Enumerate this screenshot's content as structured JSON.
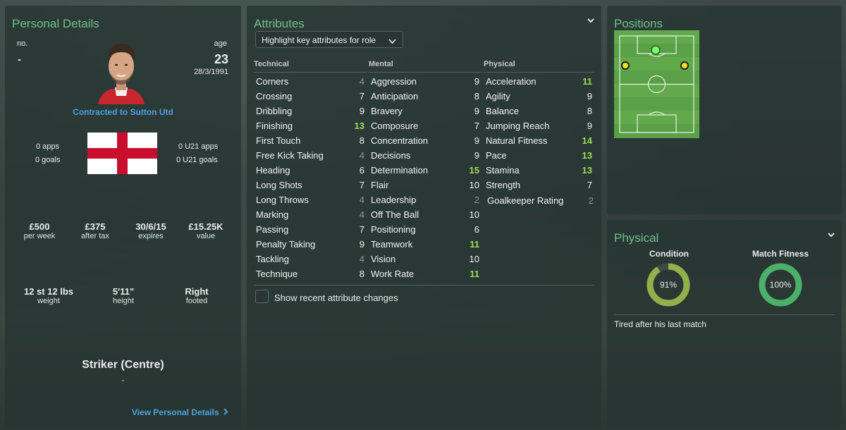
{
  "personal": {
    "title": "Personal Details",
    "no_label": "no.",
    "no_value": "-",
    "age_label": "age",
    "age_value": "23",
    "dob": "28/3/1991",
    "contract": "Contracted to Sutton Utd",
    "apps": "0 apps",
    "goals": "0 goals",
    "u21_apps": "0 U21 apps",
    "u21_goals": "0 U21 goals",
    "wage": "£500",
    "wage_label": "per week",
    "after_tax": "£375",
    "after_tax_label": "after tax",
    "expires": "30/6/15",
    "expires_label": "expires",
    "value": "£15.25K",
    "value_label": "value",
    "weight": "12 st 12 lbs",
    "weight_label": "weight",
    "height": "5'11\"",
    "height_label": "height",
    "foot": "Right",
    "foot_label": "footed",
    "position": "Striker (Centre)",
    "role": "-",
    "view_link": "View Personal Details"
  },
  "attributes": {
    "title": "Attributes",
    "dropdown": "Highlight key attributes for role",
    "col_technical": "Technical",
    "col_mental": "Mental",
    "col_physical": "Physical",
    "technical": [
      {
        "name": "Corners",
        "value": "4"
      },
      {
        "name": "Crossing",
        "value": "7"
      },
      {
        "name": "Dribbling",
        "value": "9"
      },
      {
        "name": "Finishing",
        "value": "13"
      },
      {
        "name": "First Touch",
        "value": "8"
      },
      {
        "name": "Free Kick Taking",
        "value": "4"
      },
      {
        "name": "Heading",
        "value": "6"
      },
      {
        "name": "Long Shots",
        "value": "7"
      },
      {
        "name": "Long Throws",
        "value": "4"
      },
      {
        "name": "Marking",
        "value": "4"
      },
      {
        "name": "Passing",
        "value": "7"
      },
      {
        "name": "Penalty Taking",
        "value": "9"
      },
      {
        "name": "Tackling",
        "value": "4"
      },
      {
        "name": "Technique",
        "value": "8"
      }
    ],
    "mental": [
      {
        "name": "Aggression",
        "value": "9"
      },
      {
        "name": "Anticipation",
        "value": "8"
      },
      {
        "name": "Bravery",
        "value": "9"
      },
      {
        "name": "Composure",
        "value": "7"
      },
      {
        "name": "Concentration",
        "value": "9"
      },
      {
        "name": "Decisions",
        "value": "9"
      },
      {
        "name": "Determination",
        "value": "15"
      },
      {
        "name": "Flair",
        "value": "10"
      },
      {
        "name": "Leadership",
        "value": "2"
      },
      {
        "name": "Off The Ball",
        "value": "10"
      },
      {
        "name": "Positioning",
        "value": "6"
      },
      {
        "name": "Teamwork",
        "value": "11"
      },
      {
        "name": "Vision",
        "value": "10"
      },
      {
        "name": "Work Rate",
        "value": "11"
      }
    ],
    "physical": [
      {
        "name": "Acceleration",
        "value": "11"
      },
      {
        "name": "Agility",
        "value": "9"
      },
      {
        "name": "Balance",
        "value": "8"
      },
      {
        "name": "Jumping Reach",
        "value": "9"
      },
      {
        "name": "Natural Fitness",
        "value": "14"
      },
      {
        "name": "Pace",
        "value": "13"
      },
      {
        "name": "Stamina",
        "value": "13"
      },
      {
        "name": "Strength",
        "value": "7"
      }
    ],
    "gk_label": "Goalkeeper Rating",
    "gk_value": "2",
    "checkbox_label": "Show recent attribute changes"
  },
  "positions": {
    "title": "Positions"
  },
  "physical_panel": {
    "title": "Physical",
    "condition_label": "Condition",
    "condition_value": "91%",
    "condition_fraction": 0.91,
    "fitness_label": "Match Fitness",
    "fitness_value": "100%",
    "fitness_fraction": 1.0,
    "status": "Tired after his last match"
  },
  "colors": {
    "accent": "#6fbf8a",
    "link": "#4aa3e0",
    "value_low": "#8e9794",
    "value_mid": "#f2f4f3",
    "value_high": "#9fdc5a",
    "condition_ring": "#8fb04a",
    "fitness_ring": "#4caf6a"
  }
}
